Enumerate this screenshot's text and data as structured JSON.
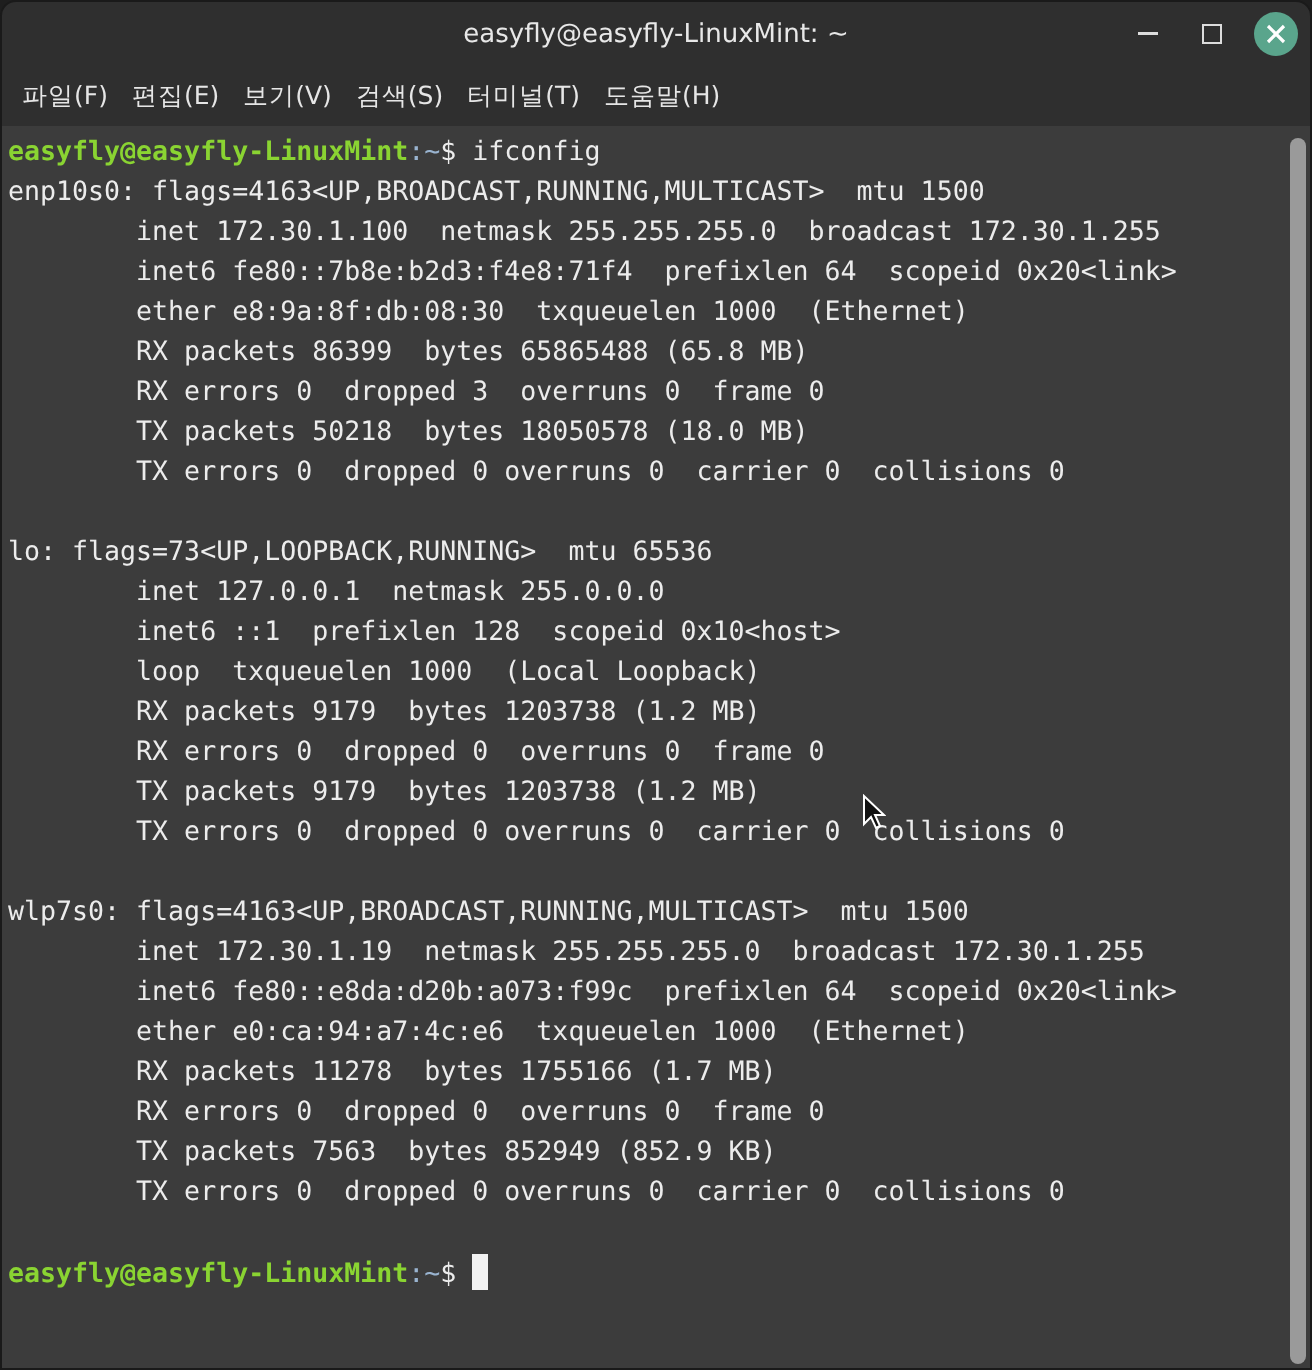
{
  "window": {
    "title": "easyfly@easyfly-LinuxMint: ~"
  },
  "menu": [
    "파일(F)",
    "편집(E)",
    "보기(V)",
    "검색(S)",
    "터미널(T)",
    "도움말(H)"
  ],
  "terminal": {
    "lines": [
      {
        "kind": "prompt",
        "user": "easyfly@easyfly-LinuxMint",
        "path": ":~",
        "symbol": "$",
        "command": " ifconfig",
        "cursor": false
      },
      {
        "kind": "output",
        "text": "enp10s0: flags=4163<UP,BROADCAST,RUNNING,MULTICAST>  mtu 1500"
      },
      {
        "kind": "output",
        "text": "        inet 172.30.1.100  netmask 255.255.255.0  broadcast 172.30.1.255"
      },
      {
        "kind": "output",
        "text": "        inet6 fe80::7b8e:b2d3:f4e8:71f4  prefixlen 64  scopeid 0x20<link>"
      },
      {
        "kind": "output",
        "text": "        ether e8:9a:8f:db:08:30  txqueuelen 1000  (Ethernet)"
      },
      {
        "kind": "output",
        "text": "        RX packets 86399  bytes 65865488 (65.8 MB)"
      },
      {
        "kind": "output",
        "text": "        RX errors 0  dropped 3  overruns 0  frame 0"
      },
      {
        "kind": "output",
        "text": "        TX packets 50218  bytes 18050578 (18.0 MB)"
      },
      {
        "kind": "output",
        "text": "        TX errors 0  dropped 0 overruns 0  carrier 0  collisions 0"
      },
      {
        "kind": "blank"
      },
      {
        "kind": "output",
        "text": "lo: flags=73<UP,LOOPBACK,RUNNING>  mtu 65536"
      },
      {
        "kind": "output",
        "text": "        inet 127.0.0.1  netmask 255.0.0.0"
      },
      {
        "kind": "output",
        "text": "        inet6 ::1  prefixlen 128  scopeid 0x10<host>"
      },
      {
        "kind": "output",
        "text": "        loop  txqueuelen 1000  (Local Loopback)"
      },
      {
        "kind": "output",
        "text": "        RX packets 9179  bytes 1203738 (1.2 MB)"
      },
      {
        "kind": "output",
        "text": "        RX errors 0  dropped 0  overruns 0  frame 0"
      },
      {
        "kind": "output",
        "text": "        TX packets 9179  bytes 1203738 (1.2 MB)"
      },
      {
        "kind": "output",
        "text": "        TX errors 0  dropped 0 overruns 0  carrier 0  collisions 0"
      },
      {
        "kind": "blank"
      },
      {
        "kind": "output",
        "text": "wlp7s0: flags=4163<UP,BROADCAST,RUNNING,MULTICAST>  mtu 1500"
      },
      {
        "kind": "output",
        "text": "        inet 172.30.1.19  netmask 255.255.255.0  broadcast 172.30.1.255"
      },
      {
        "kind": "output",
        "text": "        inet6 fe80::e8da:d20b:a073:f99c  prefixlen 64  scopeid 0x20<link>"
      },
      {
        "kind": "output",
        "text": "        ether e0:ca:94:a7:4c:e6  txqueuelen 1000  (Ethernet)"
      },
      {
        "kind": "output",
        "text": "        RX packets 11278  bytes 1755166 (1.7 MB)"
      },
      {
        "kind": "output",
        "text": "        RX errors 0  dropped 0  overruns 0  frame 0"
      },
      {
        "kind": "output",
        "text": "        TX packets 7563  bytes 852949 (852.9 KB)"
      },
      {
        "kind": "output",
        "text": "        TX errors 0  dropped 0 overruns 0  carrier 0  collisions 0"
      },
      {
        "kind": "blank"
      },
      {
        "kind": "prompt",
        "user": "easyfly@easyfly-LinuxMint",
        "path": ":~",
        "symbol": "$",
        "cursor": true
      }
    ]
  }
}
